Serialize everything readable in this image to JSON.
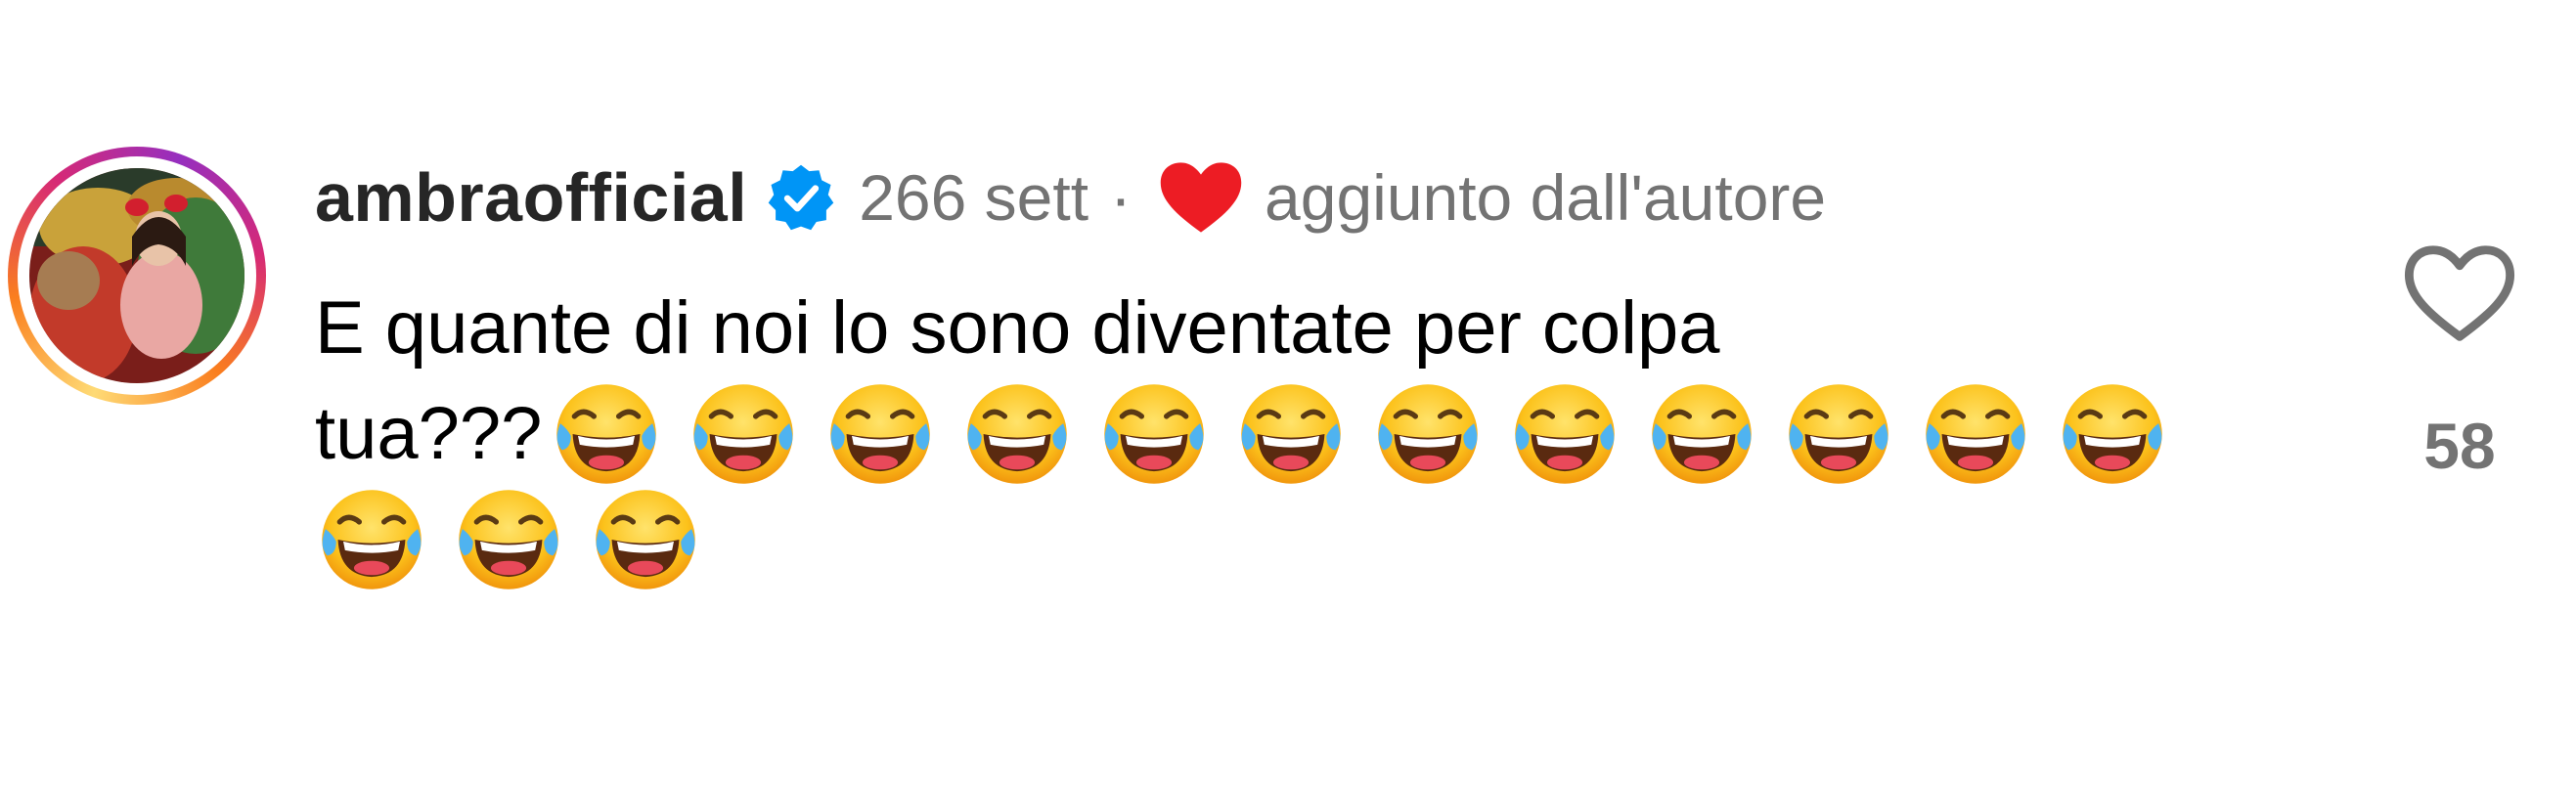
{
  "comment": {
    "username": "ambraofficial",
    "verified": true,
    "time": "266 sett",
    "separator": "·",
    "author_liked_label": "aggiunto dall'autore",
    "text_line1": "E quante di noi lo sono diventate per colpa",
    "text_line2_prefix": "tua???",
    "emoji_count": 15,
    "emoji_name": "face-with-tears-of-joy"
  },
  "like": {
    "count": "58",
    "icon": "heart-outline-icon"
  },
  "colors": {
    "username": "#262626",
    "meta": "#737373",
    "text": "#000000",
    "heart_red": "#ED1C24",
    "verified_blue": "#0095F6"
  }
}
